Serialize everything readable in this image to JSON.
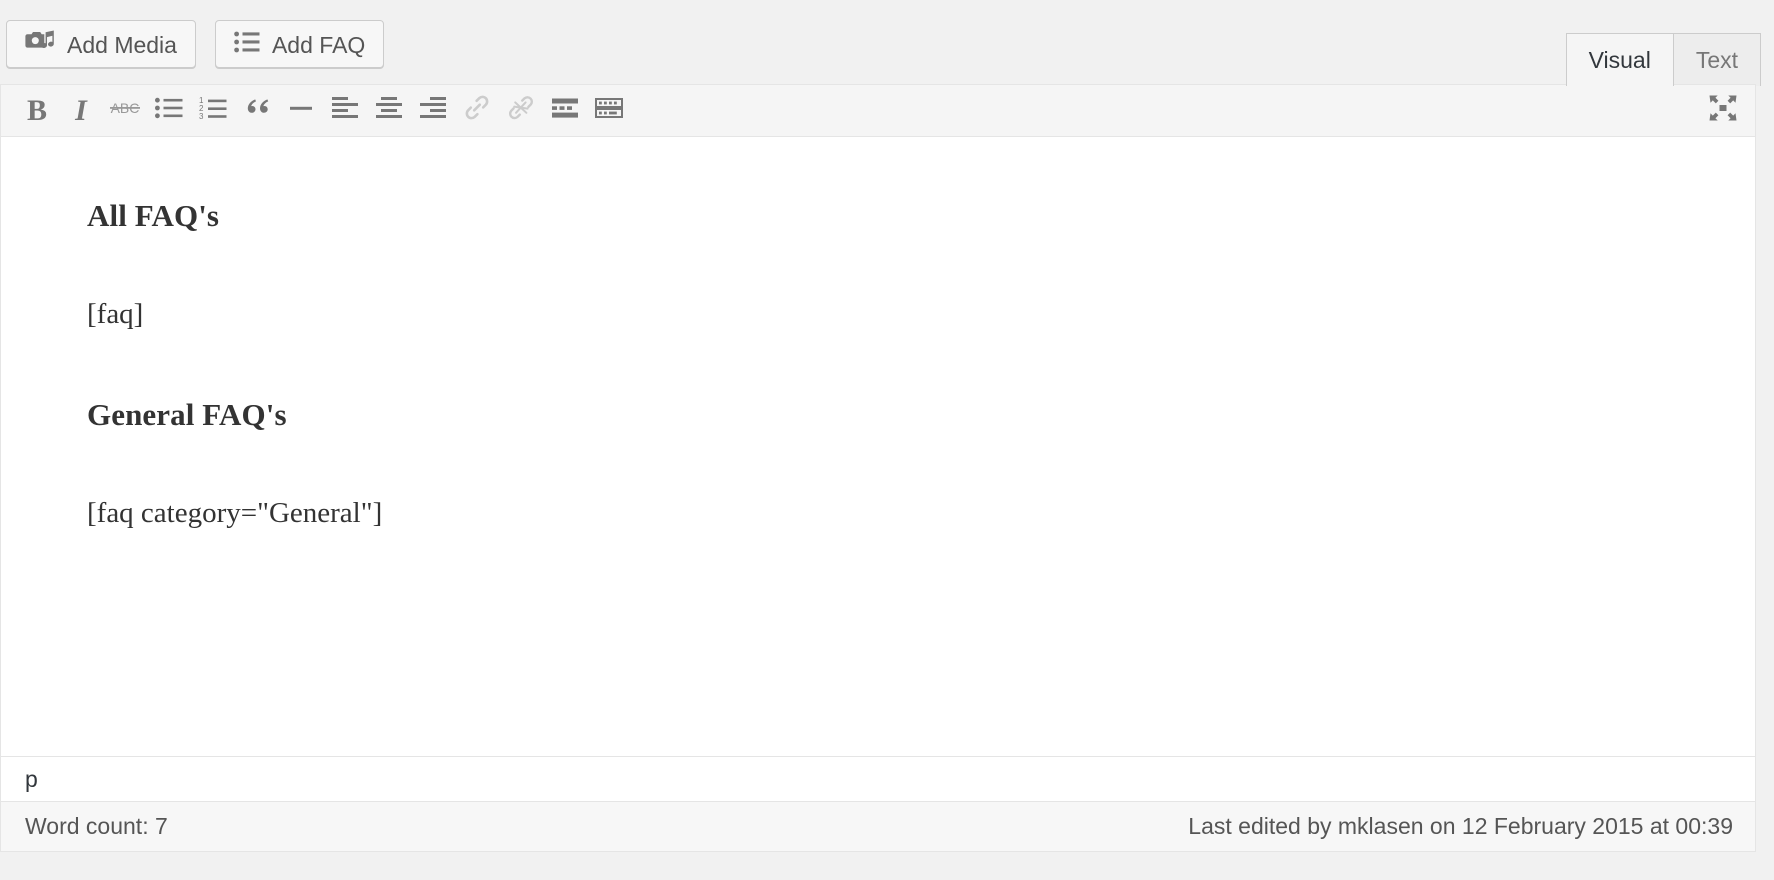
{
  "media_bar": {
    "buttons": [
      {
        "label": "Add Media",
        "icon": "camera-music-icon",
        "name": "add-media-button"
      },
      {
        "label": "Add FAQ",
        "icon": "bullet-list-icon",
        "name": "add-faq-button"
      }
    ]
  },
  "editor_tabs": [
    {
      "label": "Visual",
      "active": true
    },
    {
      "label": "Text",
      "active": false
    }
  ],
  "toolbar": {
    "buttons": [
      {
        "name": "bold-icon",
        "label": "B",
        "title": "Bold"
      },
      {
        "name": "italic-icon",
        "label": "I",
        "title": "Italic"
      },
      {
        "name": "strikethrough-icon",
        "label": "ABC",
        "title": "Strikethrough"
      },
      {
        "name": "bulleted-list-icon",
        "label": "",
        "title": "Bulleted list"
      },
      {
        "name": "numbered-list-icon",
        "label": "",
        "title": "Numbered list"
      },
      {
        "name": "blockquote-icon",
        "label": "“",
        "title": "Blockquote"
      },
      {
        "name": "horizontal-line-icon",
        "label": "",
        "title": "Horizontal line"
      },
      {
        "name": "align-left-icon",
        "label": "",
        "title": "Align left"
      },
      {
        "name": "align-center-icon",
        "label": "",
        "title": "Align center"
      },
      {
        "name": "align-right-icon",
        "label": "",
        "title": "Align right"
      },
      {
        "name": "insert-link-icon",
        "label": "",
        "title": "Insert/edit link"
      },
      {
        "name": "remove-link-icon",
        "label": "",
        "title": "Remove link"
      },
      {
        "name": "read-more-icon",
        "label": "",
        "title": "Insert Read More tag"
      },
      {
        "name": "keyboard-shortcuts-icon",
        "label": "",
        "title": "Keyboard shortcuts"
      }
    ],
    "fullscreen": {
      "name": "distraction-free-icon",
      "title": "Distraction-free writing mode"
    }
  },
  "content": {
    "blocks": [
      {
        "type": "heading",
        "text": "All FAQ's"
      },
      {
        "type": "paragraph",
        "text": "[faq]"
      },
      {
        "type": "heading",
        "text": "General FAQ's"
      },
      {
        "type": "paragraph",
        "text": "[faq category=\"General\"]"
      }
    ]
  },
  "status": {
    "element_path": "p",
    "word_count": "Word count: 7",
    "last_edited": "Last edited by mklasen on 12 February 2015 at 00:39"
  },
  "colors": {
    "page_bg": "#f1f1f1",
    "toolbar_bg": "#f5f5f5",
    "editor_bg": "#ffffff",
    "icon_gray": "#777777",
    "icon_gray_disabled": "#cccccc",
    "text": "#333333",
    "border": "#e5e5e5"
  }
}
